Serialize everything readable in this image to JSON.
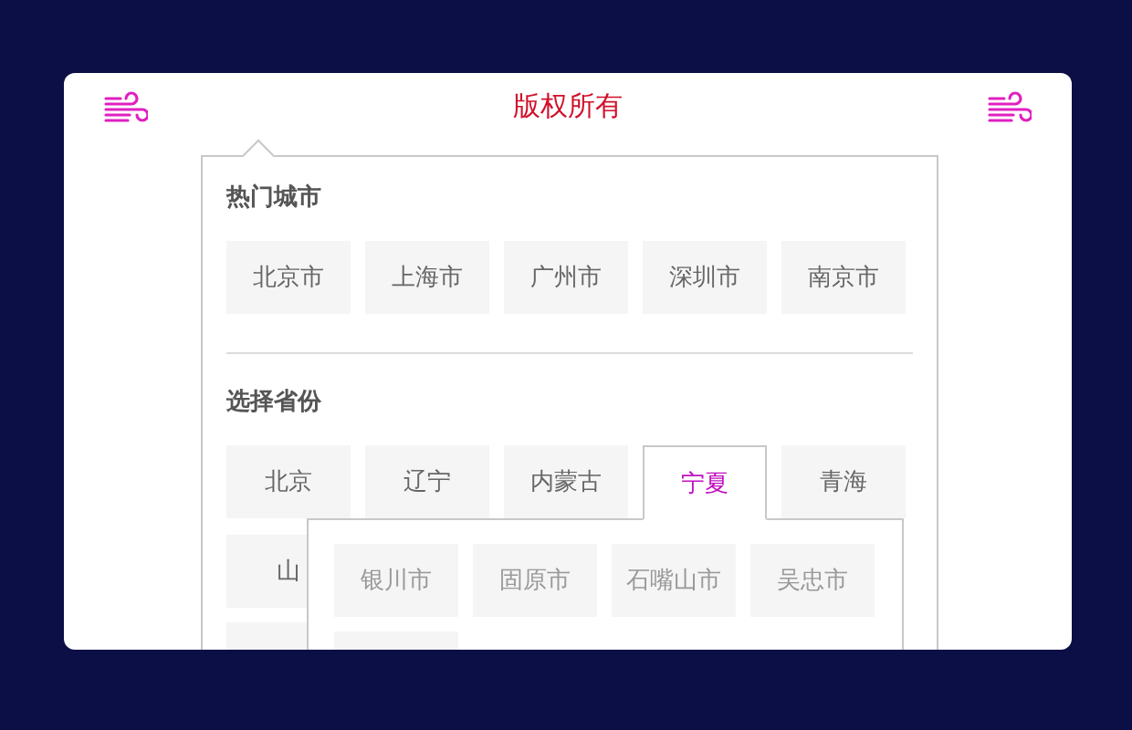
{
  "header": {
    "title": "版权所有"
  },
  "hot_cities": {
    "heading": "热门城市",
    "items": [
      "北京市",
      "上海市",
      "广州市",
      "深圳市",
      "南京市"
    ]
  },
  "provinces": {
    "heading": "选择省份",
    "items": [
      {
        "label": "北京",
        "selected": false
      },
      {
        "label": "辽宁",
        "selected": false
      },
      {
        "label": "内蒙古",
        "selected": false
      },
      {
        "label": "宁夏",
        "selected": true
      },
      {
        "label": "青海",
        "selected": false
      },
      {
        "label": "山",
        "selected": false
      }
    ]
  },
  "province_cities": [
    "银川市",
    "固原市",
    "石嘴山市",
    "吴忠市"
  ]
}
